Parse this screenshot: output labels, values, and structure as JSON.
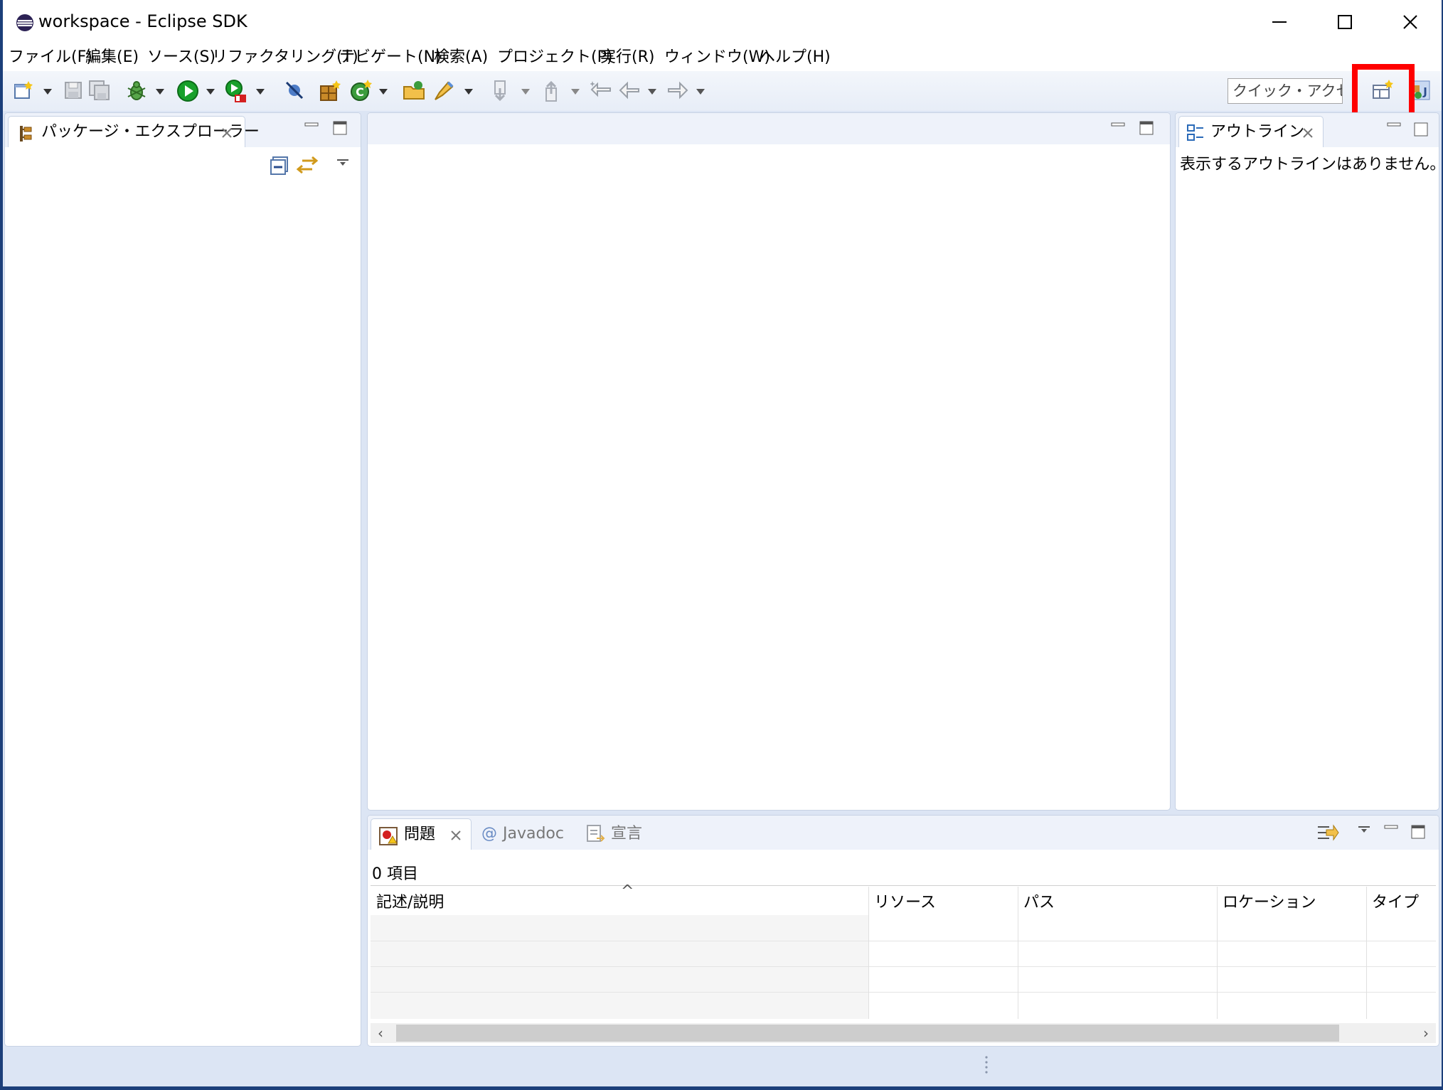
{
  "window": {
    "title": "workspace - Eclipse SDK",
    "controls": [
      "minimize",
      "maximize",
      "close"
    ]
  },
  "menu": {
    "items": [
      "ファイル(F)",
      "編集(E)",
      "ソース(S)",
      "リファクタリング(T)",
      "ナビゲート(N)",
      "検索(A)",
      "プロジェクト(P)",
      "実行(R)",
      "ウィンドウ(W)",
      "ヘルプ(H)"
    ]
  },
  "toolbar": {
    "quick_access": "クイック・アクセス",
    "icons": [
      "new-wizard-icon",
      "save-icon",
      "save-all-icon",
      "debug-icon",
      "run-icon",
      "run-coverage-icon",
      "skip-breakpoints-icon",
      "new-java-package-icon",
      "new-java-class-icon",
      "open-type-icon",
      "open-task-icon",
      "next-annotation-icon",
      "previous-annotation-icon",
      "last-edit-location-icon",
      "back-icon",
      "forward-icon",
      "open-perspective-icon",
      "java-perspective-icon"
    ],
    "highlighted_icon": "open-perspective-icon"
  },
  "package_explorer": {
    "tab": "パッケージ・エクスプローラー",
    "icons": [
      "package-explorer-icon",
      "collapse-all-icon",
      "link-with-editor-icon",
      "view-menu-icon"
    ]
  },
  "outline": {
    "tab": "アウトライン",
    "empty_message": "表示するアウトラインはありません。"
  },
  "bottom": {
    "tabs": {
      "problems": "問題",
      "javadoc": "Javadoc",
      "declaration": "宣言"
    },
    "item_count": "0 項目",
    "columns": [
      "記述/説明",
      "リソース",
      "パス",
      "ロケーション",
      "タイプ"
    ],
    "sort_indicator": "^",
    "row_count": 5
  },
  "colors": {
    "window_background": "#dce5f4",
    "panel_border": "#c7d2e4",
    "highlight": "#ff0000",
    "run_green": "#18a02b",
    "eclipse_purple": "#2c2255"
  }
}
